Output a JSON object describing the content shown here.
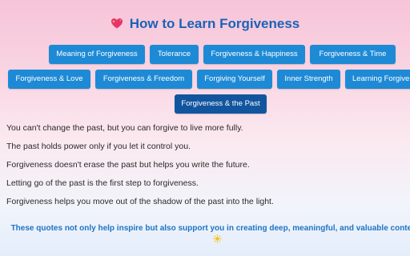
{
  "header": {
    "title": "How to Learn Forgiveness",
    "title_icon": "sparkling-heart-icon"
  },
  "tabs": [
    {
      "label": "Meaning of Forgiveness",
      "active": false
    },
    {
      "label": "Tolerance",
      "active": false
    },
    {
      "label": "Forgiveness & Happiness",
      "active": false
    },
    {
      "label": "Forgiveness & Time",
      "active": false
    },
    {
      "label": "Forgiveness & Love",
      "active": false
    },
    {
      "label": "Forgiveness & Freedom",
      "active": false
    },
    {
      "label": "Forgiving Yourself",
      "active": false
    },
    {
      "label": "Inner Strength",
      "active": false
    },
    {
      "label": "Learning Forgive",
      "active": false
    },
    {
      "label": "Forgiveness & the Past",
      "active": true
    }
  ],
  "quotes": [
    "You can't change the past, but you can forgive to live more fully.",
    "The past holds power only if you let it control you.",
    "Forgiveness doesn't erase the past but helps you write the future.",
    "Letting go of the past is the first step to forgiveness.",
    "Forgiveness helps you move out of the shadow of the past into the light."
  ],
  "footer": {
    "text": "These quotes not only help inspire but also support you in creating deep, meaningful, and valuable content.",
    "icon": "sun-icon"
  },
  "colors": {
    "accent": "#1e8ad6",
    "active": "#12559f",
    "title": "#1a63b8",
    "footer": "#1e74c4"
  }
}
